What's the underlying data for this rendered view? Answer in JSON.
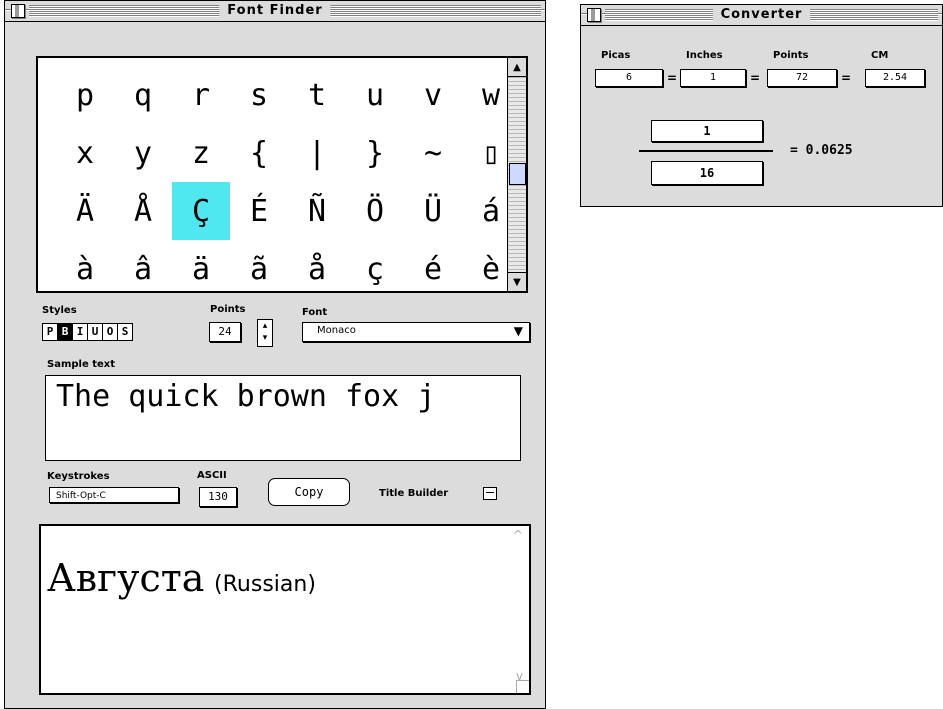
{
  "font_finder": {
    "title": "Font Finder",
    "chars": [
      "p",
      "q",
      "r",
      "s",
      "t",
      "u",
      "v",
      "w",
      "x",
      "y",
      "z",
      "{",
      "|",
      "}",
      "~",
      "▯",
      "Ä",
      "Å",
      "Ç",
      "É",
      "Ñ",
      "Ö",
      "Ü",
      "á",
      "à",
      "â",
      "ä",
      "ã",
      "å",
      "ç",
      "é",
      "è"
    ],
    "selected_index": 18,
    "styles_label": "Styles",
    "style_buttons": [
      "P",
      "B",
      "I",
      "U",
      "O",
      "S"
    ],
    "points_label": "Points",
    "points_value": "24",
    "font_label": "Font",
    "font_value": "Monaco",
    "sample_label": "Sample text",
    "sample_text": "The quick brown fox j",
    "keystrokes_label": "Keystrokes",
    "keystrokes_value": "Shift-Opt-C",
    "ascii_label": "ASCII",
    "ascii_value": "130",
    "copy_label": "Copy",
    "title_builder_label": "Title Builder",
    "preview_main": "Августа",
    "preview_note": "(Russian)",
    "highlight_color": "#4fe8f0"
  },
  "converter": {
    "title": "Converter",
    "headers": [
      "Picas",
      "Inches",
      "Points",
      "CM"
    ],
    "values": [
      "6",
      "1",
      "72",
      "2.54"
    ],
    "eq": "=",
    "numerator": "1",
    "denominator": "16",
    "result": "= 0.0625"
  }
}
